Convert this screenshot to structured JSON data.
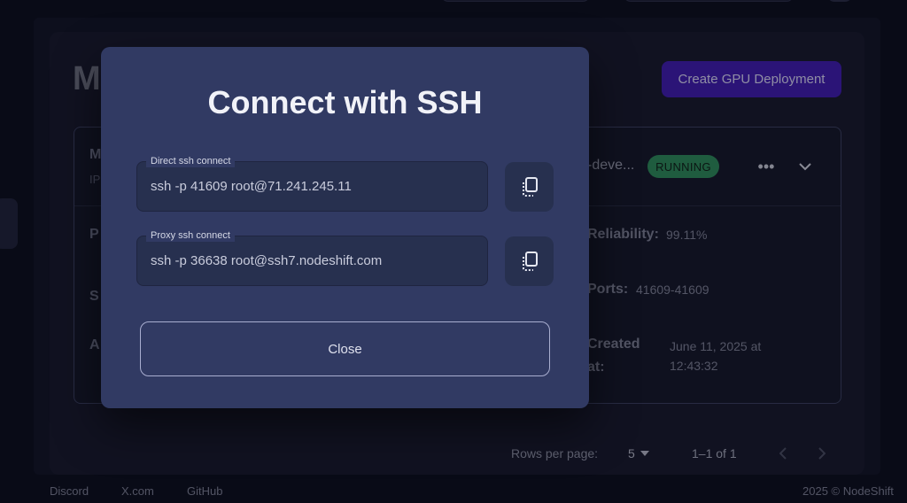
{
  "page": {
    "title_fragment": "M",
    "create_button_label": "Create GPU Deployment"
  },
  "deployment": {
    "name_fragment": "M",
    "ip_fragment": "IP",
    "row_fragments": [
      "P",
      "S",
      "A"
    ],
    "name_truncated": "-deve...",
    "status": "RUNNING",
    "reliability_label": "Reliability:",
    "reliability_value": "99.11%",
    "ports_label": "Ports:",
    "ports_value": "41609-41609",
    "created_label_line1": "Created",
    "created_label_line2": "at:",
    "created_value_line1": "June 11, 2025 at",
    "created_value_line2": "12:43:32"
  },
  "pagination": {
    "rows_per_page_label": "Rows per page:",
    "rows_per_page_value": "5",
    "range_text": "1–1 of 1"
  },
  "footer": {
    "links": [
      "Discord",
      "X.com",
      "GitHub"
    ],
    "copyright": "2025 © NodeShift"
  },
  "modal": {
    "title": "Connect with SSH",
    "direct": {
      "label": "Direct ssh connect",
      "value": "ssh -p 41609 root@71.241.245.11"
    },
    "proxy": {
      "label": "Proxy ssh connect",
      "value": "ssh -p 36638 root@ssh7.nodeshift.com"
    },
    "close_label": "Close"
  },
  "icons": {
    "copy": "copy-icon",
    "more": "more-horizontal-icon",
    "expand": "chevron-down-icon",
    "dropdown": "caret-down-icon",
    "prev": "chevron-left-icon",
    "next": "chevron-right-icon"
  },
  "colors": {
    "modal_bg": "#313a63",
    "field_bg": "#27304f",
    "primary_button": "#3f1cb0",
    "status_running": "#2d8b5a",
    "page_bg": "#0c0e1c"
  }
}
